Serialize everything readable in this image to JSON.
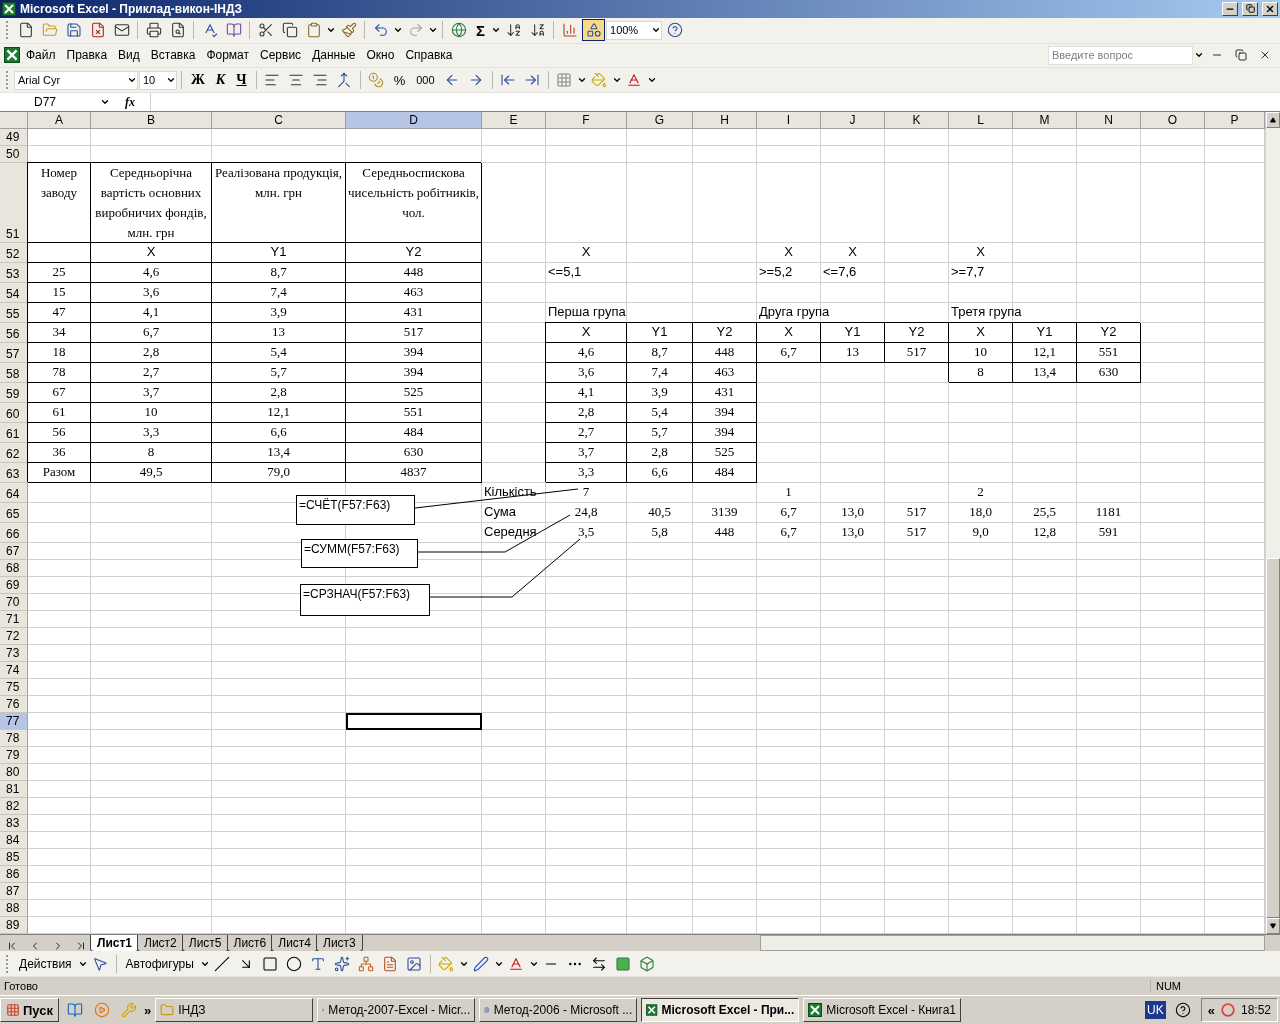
{
  "window": {
    "title": "Microsoft Excel - Приклад-викон-ІНДЗ"
  },
  "standard_toolbar": {
    "sum": "Σ",
    "zoom": "100%"
  },
  "menu": [
    "Файл",
    "Правка",
    "Вид",
    "Вставка",
    "Формат",
    "Сервис",
    "Данные",
    "Окно",
    "Справка"
  ],
  "help_search": {
    "placeholder": "Введите вопрос"
  },
  "formatting_toolbar": {
    "font": "Arial Cyr",
    "size": "10",
    "bold": "Ж",
    "italic": "К",
    "underline": "Ч",
    "percent": "%",
    "thousands": "000"
  },
  "formula_bar": {
    "name_box": "D77",
    "fx": "fx"
  },
  "sheet": {
    "columns": [
      {
        "label": "A",
        "selected": false
      },
      {
        "label": "B",
        "selected": false
      },
      {
        "label": "C",
        "selected": false
      },
      {
        "label": "D",
        "selected": true
      },
      {
        "label": "E",
        "selected": false
      },
      {
        "label": "F",
        "selected": false
      },
      {
        "label": "G",
        "selected": false
      },
      {
        "label": "H",
        "selected": false
      },
      {
        "label": "I",
        "selected": false
      },
      {
        "label": "J",
        "selected": false
      },
      {
        "label": "K",
        "selected": false
      },
      {
        "label": "L",
        "selected": false
      },
      {
        "label": "M",
        "selected": false
      },
      {
        "label": "N",
        "selected": false
      },
      {
        "label": "O",
        "selected": false
      },
      {
        "label": "P",
        "selected": false
      }
    ],
    "rows": [
      {
        "label": "49",
        "selected": false
      },
      {
        "label": "50",
        "selected": false
      },
      {
        "label": "51",
        "selected": false,
        "cells": [
          {
            "text": "Номер заводу",
            "kind": "wrap",
            "boxed": true
          },
          {
            "text": "Середньорічна вартість основних виробничих фондів, млн. грн",
            "kind": "wrap",
            "boxed": true
          },
          {
            "text": "Реалізована продукція, млн. грн",
            "kind": "wrap",
            "boxed": true
          },
          {
            "text": "Середньоспискова чисельність робітників, чол.",
            "kind": "wrap",
            "boxed": true
          }
        ]
      },
      {
        "label": "52",
        "selected": false,
        "cells": [
          {
            "kind": "value",
            "boxed": true
          },
          {
            "text": "X",
            "kind": "head",
            "boxed": true
          },
          {
            "text": "Y1",
            "kind": "head",
            "boxed": true
          },
          {
            "text": "Y2",
            "kind": "head",
            "boxed": true
          },
          null,
          {
            "text": "X",
            "kind": "head",
            "boxed": false
          },
          null,
          null,
          {
            "text": "X",
            "kind": "head",
            "boxed": false
          },
          {
            "text": "X",
            "kind": "head",
            "boxed": false
          },
          null,
          {
            "text": "X",
            "kind": "head",
            "boxed": false
          }
        ]
      },
      {
        "label": "53",
        "selected": false,
        "cells": [
          {
            "text": "25",
            "kind": "value",
            "boxed": true
          },
          {
            "text": "4,6",
            "kind": "value",
            "boxed": true
          },
          {
            "text": "8,7",
            "kind": "value",
            "boxed": true
          },
          {
            "text": "448",
            "kind": "value",
            "boxed": true
          },
          null,
          {
            "text": "<=5,1",
            "kind": "note",
            "boxed": false
          },
          null,
          null,
          {
            "text": ">=5,2",
            "kind": "note",
            "boxed": false
          },
          {
            "text": "<=7,6",
            "kind": "note",
            "boxed": false
          },
          null,
          {
            "text": ">=7,7",
            "kind": "note",
            "boxed": false
          }
        ]
      },
      {
        "label": "54",
        "selected": false,
        "cells": [
          {
            "text": "15",
            "kind": "value",
            "boxed": true
          },
          {
            "text": "3,6",
            "kind": "value",
            "boxed": true
          },
          {
            "text": "7,4",
            "kind": "value",
            "boxed": true
          },
          {
            "text": "463",
            "kind": "value",
            "boxed": true
          }
        ]
      },
      {
        "label": "55",
        "selected": false,
        "cells": [
          {
            "text": "47",
            "kind": "value",
            "boxed": true
          },
          {
            "text": "4,1",
            "kind": "value",
            "boxed": true
          },
          {
            "text": "3,9",
            "kind": "value",
            "boxed": true
          },
          {
            "text": "431",
            "kind": "value",
            "boxed": true
          },
          null,
          {
            "text": "Перша група",
            "kind": "note",
            "boxed": false
          },
          null,
          null,
          {
            "text": "Друга група",
            "kind": "note",
            "boxed": false
          },
          null,
          null,
          {
            "text": "Третя група",
            "kind": "note",
            "boxed": false
          }
        ]
      },
      {
        "label": "56",
        "selected": false,
        "cells": [
          {
            "text": "34",
            "kind": "value",
            "boxed": true
          },
          {
            "text": "6,7",
            "kind": "value",
            "boxed": true
          },
          {
            "text": "13",
            "kind": "value",
            "boxed": true
          },
          {
            "text": "517",
            "kind": "value",
            "boxed": true
          },
          null,
          {
            "text": "X",
            "kind": "head",
            "boxed": true
          },
          {
            "text": "Y1",
            "kind": "head",
            "boxed": true
          },
          {
            "text": "Y2",
            "kind": "head",
            "boxed": true
          },
          {
            "text": "X",
            "kind": "head",
            "boxed": true
          },
          {
            "text": "Y1",
            "kind": "head",
            "boxed": true
          },
          {
            "text": "Y2",
            "kind": "head",
            "boxed": true
          },
          {
            "text": "X",
            "kind": "head",
            "boxed": true
          },
          {
            "text": "Y1",
            "kind": "head",
            "boxed": true
          },
          {
            "text": "Y2",
            "kind": "head",
            "boxed": true
          }
        ]
      },
      {
        "label": "57",
        "selected": false,
        "cells": [
          {
            "text": "18",
            "kind": "value",
            "boxed": true
          },
          {
            "text": "2,8",
            "kind": "value",
            "boxed": true
          },
          {
            "text": "5,4",
            "kind": "value",
            "boxed": true
          },
          {
            "text": "394",
            "kind": "value",
            "boxed": true
          },
          null,
          {
            "text": "4,6",
            "kind": "value",
            "boxed": true
          },
          {
            "text": "8,7",
            "kind": "value",
            "boxed": true
          },
          {
            "text": "448",
            "kind": "value",
            "boxed": true
          },
          {
            "text": "6,7",
            "kind": "value",
            "boxed": true
          },
          {
            "text": "13",
            "kind": "value",
            "boxed": true
          },
          {
            "text": "517",
            "kind": "value",
            "boxed": true
          },
          {
            "text": "10",
            "kind": "value",
            "boxed": true
          },
          {
            "text": "12,1",
            "kind": "value",
            "boxed": true
          },
          {
            "text": "551",
            "kind": "value",
            "boxed": true
          }
        ]
      },
      {
        "label": "58",
        "selected": false,
        "cells": [
          {
            "text": "78",
            "kind": "value",
            "boxed": true
          },
          {
            "text": "2,7",
            "kind": "value",
            "boxed": true
          },
          {
            "text": "5,7",
            "kind": "value",
            "boxed": true
          },
          {
            "text": "394",
            "kind": "value",
            "boxed": true
          },
          null,
          {
            "text": "3,6",
            "kind": "value",
            "boxed": true
          },
          {
            "text": "7,4",
            "kind": "value",
            "boxed": true
          },
          {
            "text": "463",
            "kind": "value",
            "boxed": true
          },
          null,
          null,
          null,
          {
            "text": "8",
            "kind": "value",
            "boxed": true
          },
          {
            "text": "13,4",
            "kind": "value",
            "boxed": true
          },
          {
            "text": "630",
            "kind": "value",
            "boxed": true
          }
        ]
      },
      {
        "label": "59",
        "selected": false,
        "cells": [
          {
            "text": "67",
            "kind": "value",
            "boxed": true
          },
          {
            "text": "3,7",
            "kind": "value",
            "boxed": true
          },
          {
            "text": "2,8",
            "kind": "value",
            "boxed": true
          },
          {
            "text": "525",
            "kind": "value",
            "boxed": true
          },
          null,
          {
            "text": "4,1",
            "kind": "value",
            "boxed": true
          },
          {
            "text": "3,9",
            "kind": "value",
            "boxed": true
          },
          {
            "text": "431",
            "kind": "value",
            "boxed": true
          }
        ]
      },
      {
        "label": "60",
        "selected": false,
        "cells": [
          {
            "text": "61",
            "kind": "value",
            "boxed": true
          },
          {
            "text": "10",
            "kind": "value",
            "boxed": true
          },
          {
            "text": "12,1",
            "kind": "value",
            "boxed": true
          },
          {
            "text": "551",
            "kind": "value",
            "boxed": true
          },
          null,
          {
            "text": "2,8",
            "kind": "value",
            "boxed": true
          },
          {
            "text": "5,4",
            "kind": "value",
            "boxed": true
          },
          {
            "text": "394",
            "kind": "value",
            "boxed": true
          }
        ]
      },
      {
        "label": "61",
        "selected": false,
        "cells": [
          {
            "text": "56",
            "kind": "value",
            "boxed": true
          },
          {
            "text": "3,3",
            "kind": "value",
            "boxed": true
          },
          {
            "text": "6,6",
            "kind": "value",
            "boxed": true
          },
          {
            "text": "484",
            "kind": "value",
            "boxed": true
          },
          null,
          {
            "text": "2,7",
            "kind": "value",
            "boxed": true
          },
          {
            "text": "5,7",
            "kind": "value",
            "boxed": true
          },
          {
            "text": "394",
            "kind": "value",
            "boxed": true
          }
        ]
      },
      {
        "label": "62",
        "selected": false,
        "cells": [
          {
            "text": "36",
            "kind": "value",
            "boxed": true
          },
          {
            "text": "8",
            "kind": "value",
            "boxed": true
          },
          {
            "text": "13,4",
            "kind": "value",
            "boxed": true
          },
          {
            "text": "630",
            "kind": "value",
            "boxed": true
          },
          null,
          {
            "text": "3,7",
            "kind": "value",
            "boxed": true
          },
          {
            "text": "2,8",
            "kind": "value",
            "boxed": true
          },
          {
            "text": "525",
            "kind": "value",
            "boxed": true
          }
        ]
      },
      {
        "label": "63",
        "selected": false,
        "cells": [
          {
            "text": "Разом",
            "kind": "value",
            "boxed": true
          },
          {
            "text": "49,5",
            "kind": "value",
            "boxed": true
          },
          {
            "text": "79,0",
            "kind": "value",
            "boxed": true
          },
          {
            "text": "4837",
            "kind": "value",
            "boxed": true
          },
          null,
          {
            "text": "3,3",
            "kind": "value",
            "boxed": true
          },
          {
            "text": "6,6",
            "kind": "value",
            "boxed": true
          },
          {
            "text": "484",
            "kind": "value",
            "boxed": true
          }
        ]
      },
      {
        "label": "64",
        "selected": false,
        "cells": [
          null,
          null,
          null,
          null,
          {
            "text": "Кількість",
            "kind": "note",
            "boxed": false
          },
          {
            "text": "7",
            "kind": "value",
            "boxed": false
          },
          null,
          null,
          {
            "text": "1",
            "kind": "value",
            "boxed": false
          },
          null,
          null,
          {
            "text": "2",
            "kind": "value",
            "boxed": false
          }
        ]
      },
      {
        "label": "65",
        "selected": false,
        "cells": [
          null,
          null,
          null,
          null,
          {
            "text": "Сума",
            "kind": "note",
            "boxed": false
          },
          {
            "text": "24,8",
            "kind": "value",
            "boxed": false
          },
          {
            "text": "40,5",
            "kind": "value",
            "boxed": false
          },
          {
            "text": "3139",
            "kind": "value",
            "boxed": false
          },
          {
            "text": "6,7",
            "kind": "value",
            "boxed": false
          },
          {
            "text": "13,0",
            "kind": "value",
            "boxed": false
          },
          {
            "text": "517",
            "kind": "value",
            "boxed": false
          },
          {
            "text": "18,0",
            "kind": "value",
            "boxed": false
          },
          {
            "text": "25,5",
            "kind": "value",
            "boxed": false
          },
          {
            "text": "1181",
            "kind": "value",
            "boxed": false
          }
        ]
      },
      {
        "label": "66",
        "selected": false,
        "cells": [
          null,
          null,
          null,
          null,
          {
            "text": "Середня",
            "kind": "note",
            "boxed": false
          },
          {
            "text": "3,5",
            "kind": "value",
            "boxed": false
          },
          {
            "text": "5,8",
            "kind": "value",
            "boxed": false
          },
          {
            "text": "448",
            "kind": "value",
            "boxed": false
          },
          {
            "text": "6,7",
            "kind": "value",
            "boxed": false
          },
          {
            "text": "13,0",
            "kind": "value",
            "boxed": false
          },
          {
            "text": "517",
            "kind": "value",
            "boxed": false
          },
          {
            "text": "9,0",
            "kind": "value",
            "boxed": false
          },
          {
            "text": "12,8",
            "kind": "value",
            "boxed": false
          },
          {
            "text": "591",
            "kind": "value",
            "boxed": false
          }
        ]
      },
      {
        "label": "67",
        "selected": false
      },
      {
        "label": "68",
        "selected": false
      },
      {
        "label": "69",
        "selected": false
      },
      {
        "label": "70",
        "selected": false
      },
      {
        "label": "71",
        "selected": false
      },
      {
        "label": "72",
        "selected": false
      },
      {
        "label": "73",
        "selected": false
      },
      {
        "label": "74",
        "selected": false
      },
      {
        "label": "75",
        "selected": false
      },
      {
        "label": "76",
        "selected": false
      },
      {
        "label": "77",
        "selected": true
      },
      {
        "label": "78",
        "selected": false
      },
      {
        "label": "79",
        "selected": false
      },
      {
        "label": "80",
        "selected": false
      },
      {
        "label": "81",
        "selected": false
      },
      {
        "label": "82",
        "selected": false
      },
      {
        "label": "83",
        "selected": false
      },
      {
        "label": "84",
        "selected": false
      },
      {
        "label": "85",
        "selected": false
      },
      {
        "label": "86",
        "selected": false
      },
      {
        "label": "87",
        "selected": false
      },
      {
        "label": "88",
        "selected": false
      },
      {
        "label": "89",
        "selected": false
      }
    ],
    "callouts": [
      {
        "text": "=СЧЁТ(F57:F63)"
      },
      {
        "text": "=СУММ(F57:F63)"
      },
      {
        "text": "=СРЗНАЧ(F57:F63)"
      }
    ]
  },
  "sheet_tabs": [
    {
      "label": "Лист1",
      "selected": true
    },
    {
      "label": "Лист2",
      "selected": false
    },
    {
      "label": "Лист5",
      "selected": false
    },
    {
      "label": "Лист6",
      "selected": false
    },
    {
      "label": "Лист4",
      "selected": false
    },
    {
      "label": "Лист3",
      "selected": false
    }
  ],
  "drawing_toolbar": {
    "actions": "Действия",
    "autoshapes": "Автофигуры"
  },
  "status_bar": {
    "text": "Готово",
    "indicators": [
      "NUM"
    ]
  },
  "taskbar": {
    "start": "Пуск",
    "more": "»",
    "items": [
      {
        "label": "ІНДЗ",
        "kind": "folder",
        "selected": false
      },
      {
        "label": "Метод-2007-Excel - Micr...",
        "kind": "word",
        "selected": false
      },
      {
        "label": "Метод-2006 - Microsoft ...",
        "kind": "word",
        "selected": false
      },
      {
        "label": "Microsoft Excel - При...",
        "kind": "excel",
        "selected": true
      },
      {
        "label": "Microsoft Excel - Книга1",
        "kind": "excel",
        "selected": false
      }
    ],
    "tray": {
      "language": "UK",
      "expand": "«",
      "time": "18:52"
    }
  }
}
